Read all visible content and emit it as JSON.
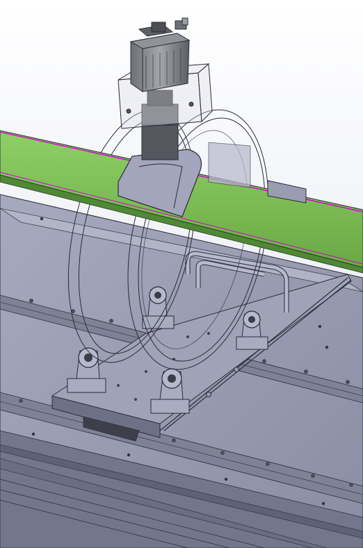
{
  "scene": {
    "kind": "cad-assembly-view",
    "colors": {
      "background_top": "#ffffff",
      "background_bottom": "#dfe3ee",
      "base_plate": "#9a9cb2",
      "base_plate_dark": "#6e7087",
      "rail": "#7f8197",
      "green_bar": "#7fbe59",
      "green_bar_dark": "#4f8a32",
      "magenta_edge": "#d400d4",
      "motor_body": "#8c8f94",
      "motor_dark": "#3d3f44",
      "part_gray": "#a9abc1",
      "wire_line": "#2a2b35"
    },
    "components": [
      {
        "name": "stepper-motor"
      },
      {
        "name": "motor-mount-bracket"
      },
      {
        "name": "coupling-shaft"
      },
      {
        "name": "clamp-block"
      },
      {
        "name": "green-bar-workpiece"
      },
      {
        "name": "ring-frame"
      },
      {
        "name": "pillow-block-bearing"
      },
      {
        "name": "carriage-plate"
      },
      {
        "name": "linear-guide-rail"
      },
      {
        "name": "base-frame"
      },
      {
        "name": "handle-bar"
      }
    ]
  }
}
